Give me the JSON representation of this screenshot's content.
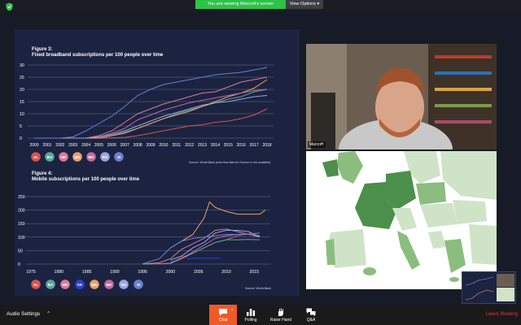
{
  "banner": {
    "message": "You are viewing MarcoH's screen",
    "options": "View Options"
  },
  "colors": {
    "AL": "#d9534f",
    "BA": "#5aa79a",
    "HR": "#d97a9a",
    "XK": "#2f3dd6",
    "ME": "#e8a06a",
    "MK": "#c06aa0",
    "RS": "#9aa6e0",
    "SI": "#6a7fd0"
  },
  "chart1": {
    "title_line1": "Figure 3:",
    "title_line2": "Fixed broadband subscriptions per 100 people over time",
    "source": "Source: World Bank (note that data for Kosovo is not available)",
    "legend": [
      "AL",
      "BA",
      "HR",
      "ME",
      "MK",
      "RS",
      "SI"
    ]
  },
  "chart2": {
    "title_line1": "Figure 4:",
    "title_line2": "Mobile subscriptions per 100 people over time",
    "source": "Source: World Bank",
    "legend": [
      "AL",
      "BA",
      "HR",
      "XK",
      "ME",
      "MK",
      "RS",
      "SI"
    ]
  },
  "chart_data": [
    {
      "type": "line",
      "title": "Fixed broadband subscriptions per 100 people over time",
      "x": [
        2000,
        2001,
        2002,
        2003,
        2004,
        2005,
        2006,
        2007,
        2008,
        2009,
        2010,
        2011,
        2012,
        2013,
        2014,
        2015,
        2016,
        2017,
        2018
      ],
      "ylim": [
        0,
        30
      ],
      "yticks": [
        0,
        5,
        10,
        15,
        20,
        25,
        30
      ],
      "series": [
        {
          "name": "AL",
          "values": [
            0,
            0,
            0,
            0,
            0,
            0,
            0.1,
            0.3,
            1,
            2,
            3,
            4,
            5,
            5.5,
            6.5,
            7,
            8,
            9.5,
            12
          ]
        },
        {
          "name": "BA",
          "values": [
            0,
            0,
            0,
            0,
            0,
            0,
            1,
            2.5,
            4,
            6,
            8,
            10,
            11.5,
            13,
            14.5,
            16,
            17,
            19,
            20
          ]
        },
        {
          "name": "HR",
          "values": [
            0,
            0,
            0,
            0,
            0,
            1,
            3,
            6.5,
            10,
            12,
            14,
            15.5,
            17,
            18.5,
            19,
            21,
            23,
            24,
            25
          ]
        },
        {
          "name": "ME",
          "values": [
            0,
            0,
            0,
            0,
            0,
            0,
            1,
            2,
            4,
            6,
            8,
            9.5,
            11,
            13,
            15,
            17,
            18.5,
            20.5,
            24
          ]
        },
        {
          "name": "MK",
          "values": [
            0,
            0,
            0,
            0,
            0,
            0.5,
            2,
            4,
            7.5,
            9.5,
            11.5,
            13,
            14.5,
            15.5,
            16.5,
            17.5,
            18.5,
            19.5,
            20
          ]
        },
        {
          "name": "RS",
          "values": [
            0,
            0,
            0,
            0,
            0,
            0.5,
            1.5,
            3,
            5,
            7,
            9,
            10.5,
            12,
            13.5,
            14.5,
            15,
            16,
            17,
            17.5
          ]
        },
        {
          "name": "SI",
          "values": [
            0,
            0,
            0,
            0.5,
            3,
            6,
            9,
            13,
            17.5,
            20,
            22,
            23,
            24,
            25,
            26,
            26.5,
            27,
            28,
            29
          ]
        }
      ]
    },
    {
      "type": "line",
      "title": "Mobile subscriptions per 100 people over time",
      "x": [
        1975,
        1980,
        1985,
        1990,
        1995,
        2000,
        2005,
        2010,
        2015
      ],
      "ylim": [
        0,
        250
      ],
      "yticks": [
        0,
        50,
        100,
        150,
        200,
        250
      ],
      "series": [
        {
          "name": "AL",
          "x": [
            1995,
            1998,
            2000,
            2002,
            2004,
            2006,
            2008,
            2010,
            2012,
            2014,
            2016
          ],
          "values": [
            0,
            0.5,
            2,
            25,
            40,
            60,
            80,
            90,
            105,
            112,
            115
          ]
        },
        {
          "name": "BA",
          "x": [
            1995,
            1998,
            2000,
            2002,
            2004,
            2006,
            2008,
            2010,
            2012,
            2014,
            2016
          ],
          "values": [
            0,
            1,
            3,
            20,
            40,
            60,
            80,
            90,
            90,
            91,
            90
          ]
        },
        {
          "name": "HR",
          "x": [
            1995,
            1998,
            2000,
            2002,
            2004,
            2006,
            2008,
            2010,
            2012,
            2014,
            2016
          ],
          "values": [
            0.5,
            5,
            20,
            55,
            75,
            95,
            125,
            130,
            120,
            110,
            105
          ]
        },
        {
          "name": "XK",
          "x": [
            2003,
            2005,
            2007,
            2009
          ],
          "values": [
            20,
            22,
            22,
            22
          ]
        },
        {
          "name": "ME",
          "x": [
            2000,
            2002,
            2004,
            2006,
            2007,
            2008,
            2010,
            2012,
            2014,
            2016,
            2017
          ],
          "values": [
            60,
            85,
            110,
            170,
            230,
            210,
            195,
            185,
            185,
            185,
            200
          ]
        },
        {
          "name": "MK",
          "x": [
            2000,
            2002,
            2004,
            2006,
            2008,
            2010,
            2012,
            2014,
            2016
          ],
          "values": [
            6,
            20,
            45,
            70,
            95,
            105,
            110,
            110,
            100
          ]
        },
        {
          "name": "RS",
          "x": [
            2000,
            2002,
            2004,
            2006,
            2008,
            2010,
            2012,
            2014,
            2016
          ],
          "values": [
            15,
            30,
            60,
            80,
            115,
            125,
            125,
            120,
            100
          ]
        },
        {
          "name": "SI",
          "x": [
            1995,
            1998,
            2000,
            2002,
            2004,
            2006,
            2008,
            2010,
            2012,
            2014,
            2016
          ],
          "values": [
            1,
            20,
            60,
            85,
            95,
            100,
            105,
            110,
            110,
            112,
            115
          ]
        }
      ]
    }
  ],
  "camera": {
    "name": "MarcoH"
  },
  "map_data": {
    "dark": [
      "#4c8f4a"
    ],
    "mid": [
      "#8bbd7f"
    ],
    "light": [
      "#cfe4c7"
    ]
  },
  "toolbar": {
    "audio": "Audio Settings",
    "chat": "Chat",
    "chat_badge": "4",
    "polling": "Polling",
    "raise_hand": "Raise Hand",
    "qa": "Q&A",
    "leave": "Leave Meeting"
  }
}
